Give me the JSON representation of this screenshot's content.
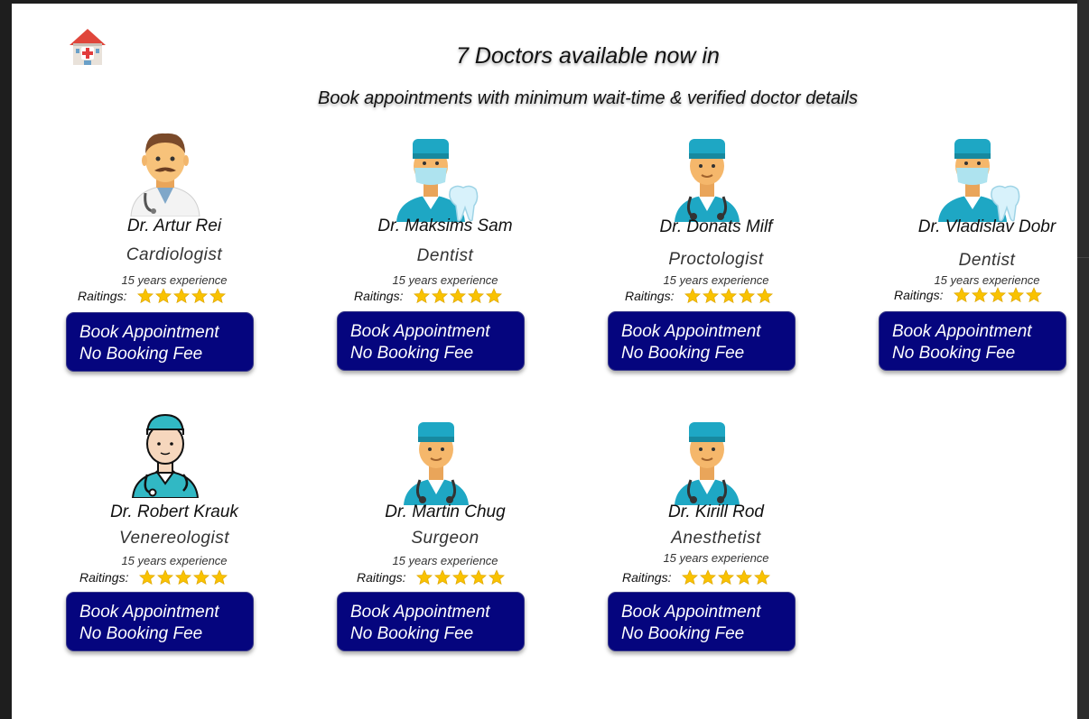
{
  "header": {
    "logo_icon": "hospital-icon",
    "title": "7 Doctors available now in",
    "subtitle": "Book appointments with minimum wait-time & verified doctor details"
  },
  "colors": {
    "button_bg": "#05057e",
    "button_text": "#ffffff",
    "star": "#f9c200",
    "avatar_cap": "#1ea7c4"
  },
  "doctors": [
    {
      "name": "Dr. Artur Rei",
      "specialty": "Cardiologist",
      "experience": "15 years experience",
      "rating_label": "Raitings:",
      "stars": 5,
      "avatar": "man-doctor-emoji-icon",
      "book_label": "Book Appointment",
      "fee_label": "No Booking Fee"
    },
    {
      "name": "Dr. Maksims Sam",
      "specialty": "Dentist",
      "experience": "15 years experience",
      "rating_label": "Raitings:",
      "stars": 5,
      "avatar": "dentist-icon",
      "book_label": "Book Appointment",
      "fee_label": "No Booking Fee"
    },
    {
      "name": "Dr. Donats Milf",
      "specialty": "Proctologist",
      "experience": "15 years experience",
      "rating_label": "Raitings:",
      "stars": 5,
      "avatar": "doctor-stethoscope-icon",
      "book_label": "Book Appointment",
      "fee_label": "No Booking Fee"
    },
    {
      "name": "Dr. Vladislav Dobr",
      "specialty": "Dentist",
      "experience": "15 years experience",
      "rating_label": "Raitings:",
      "stars": 5,
      "avatar": "dentist-icon",
      "book_label": "Book Appointment",
      "fee_label": "No Booking Fee"
    },
    {
      "name": "Dr. Robert Krauk",
      "specialty": "Venereologist",
      "experience": "15 years experience",
      "rating_label": "Raitings:",
      "stars": 5,
      "avatar": "doctor-outline-icon",
      "book_label": "Book Appointment",
      "fee_label": "No Booking Fee"
    },
    {
      "name": "Dr. Martin Chug",
      "specialty": "Surgeon",
      "experience": "15 years experience",
      "rating_label": "Raitings:",
      "stars": 5,
      "avatar": "doctor-stethoscope-icon",
      "book_label": "Book Appointment",
      "fee_label": "No Booking Fee"
    },
    {
      "name": "Dr. Kirill Rod",
      "specialty": "Anesthetist",
      "experience": "15 years experience",
      "rating_label": "Raitings:",
      "stars": 5,
      "avatar": "doctor-stethoscope-icon",
      "book_label": "Book Appointment",
      "fee_label": "No Booking Fee"
    }
  ]
}
